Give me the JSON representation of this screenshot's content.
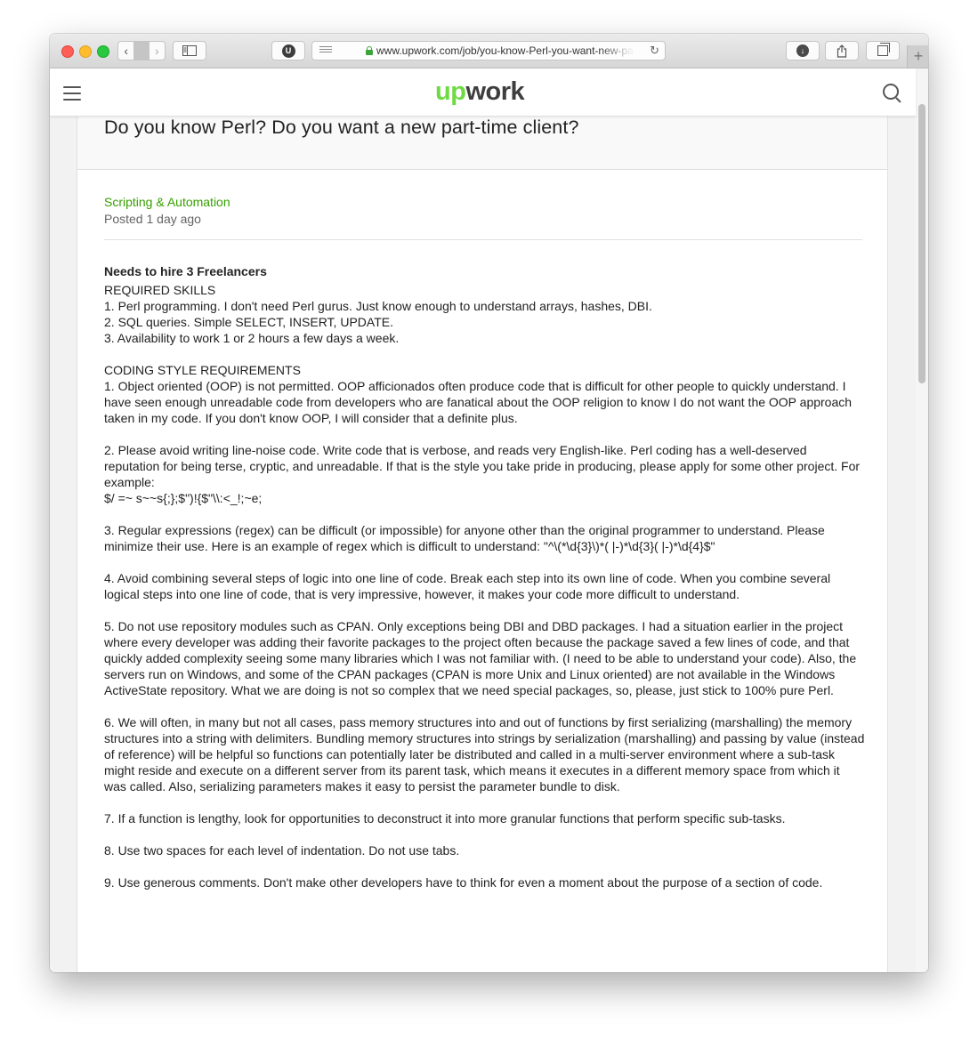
{
  "browser": {
    "url": "www.upwork.com/job/you-know-Perl-you-want-new-part-time-client",
    "extension_badge": "U"
  },
  "header": {
    "logo_up": "up",
    "logo_work": "work"
  },
  "job": {
    "title": "Do you know Perl? Do you want a new part-time client?",
    "category": "Scripting & Automation",
    "posted": "Posted 1 day ago",
    "hire": "Needs to hire 3 Freelancers",
    "description": [
      "REQUIRED SKILLS\n1. Perl programming. I don't need Perl gurus.  Just know enough to understand arrays, hashes, DBI.\n2. SQL queries. Simple SELECT, INSERT, UPDATE.\n3. Availability to work 1 or 2 hours a few days a week.",
      "CODING STYLE REQUIREMENTS\n1. Object oriented (OOP) is not permitted. OOP afficionados often produce code that is difficult for other people to quickly understand. I have seen enough unreadable code from developers who are fanatical about the OOP religion to know I do not want the OOP approach taken in my code. If you don't know OOP, I will consider that a definite plus.",
      "2. Please avoid writing line-noise code.  Write code that is verbose, and reads very English-like. Perl coding has a well-deserved reputation for being terse, cryptic, and unreadable. If that is the style you take pride in producing, please apply for some other project.  For example:\n$/ =~ s~~s{;};$\")!{$\"\\\\:<_!;~e;",
      "3. Regular expressions (regex) can be difficult (or impossible) for anyone other than the original programmer to understand. Please minimize their use. Here is an example of regex which is difficult to understand: \"^\\(*\\d{3}\\)*( |-)*\\d{3}( |-)*\\d{4}$\"",
      "4. Avoid combining several steps of logic into one line of code. Break each step into its own line of code. When you combine several logical steps into one line of code, that is very impressive, however, it makes your code more difficult to understand.",
      "5. Do not use repository modules such as CPAN. Only exceptions being DBI and DBD packages. I had a situation earlier in the project where every developer was adding their favorite packages to the project often because the package saved a few lines of code, and that quickly added complexity seeing some many libraries which I was not familiar with. (I need to be able to understand your code). Also, the servers run on Windows, and some of the CPAN packages (CPAN is more Unix and Linux oriented) are not available in the Windows ActiveState repository. What we are doing is not so complex that we need special packages, so, please, just stick to 100% pure Perl.",
      "6.  We will often, in many but not all cases, pass memory structures into and out of functions by first serializing (marshalling) the memory structures into a string with delimiters. Bundling memory structures into strings by serialization (marshalling) and passing by value (instead of reference) will be helpful so functions can potentially later be distributed and called in a multi-server environment where a sub-task might reside and execute on a different server from its parent task, which means it executes in a different memory space from which it was called. Also, serializing parameters makes it easy to persist the parameter bundle to disk.",
      "7. If a function is lengthy, look for opportunities to deconstruct it into more granular functions that perform specific sub-tasks.",
      "8. Use two spaces for each level of indentation. Do not use tabs.",
      "9. Use generous comments. Don't make other developers have to think for even a moment about the purpose of a section of code."
    ]
  }
}
